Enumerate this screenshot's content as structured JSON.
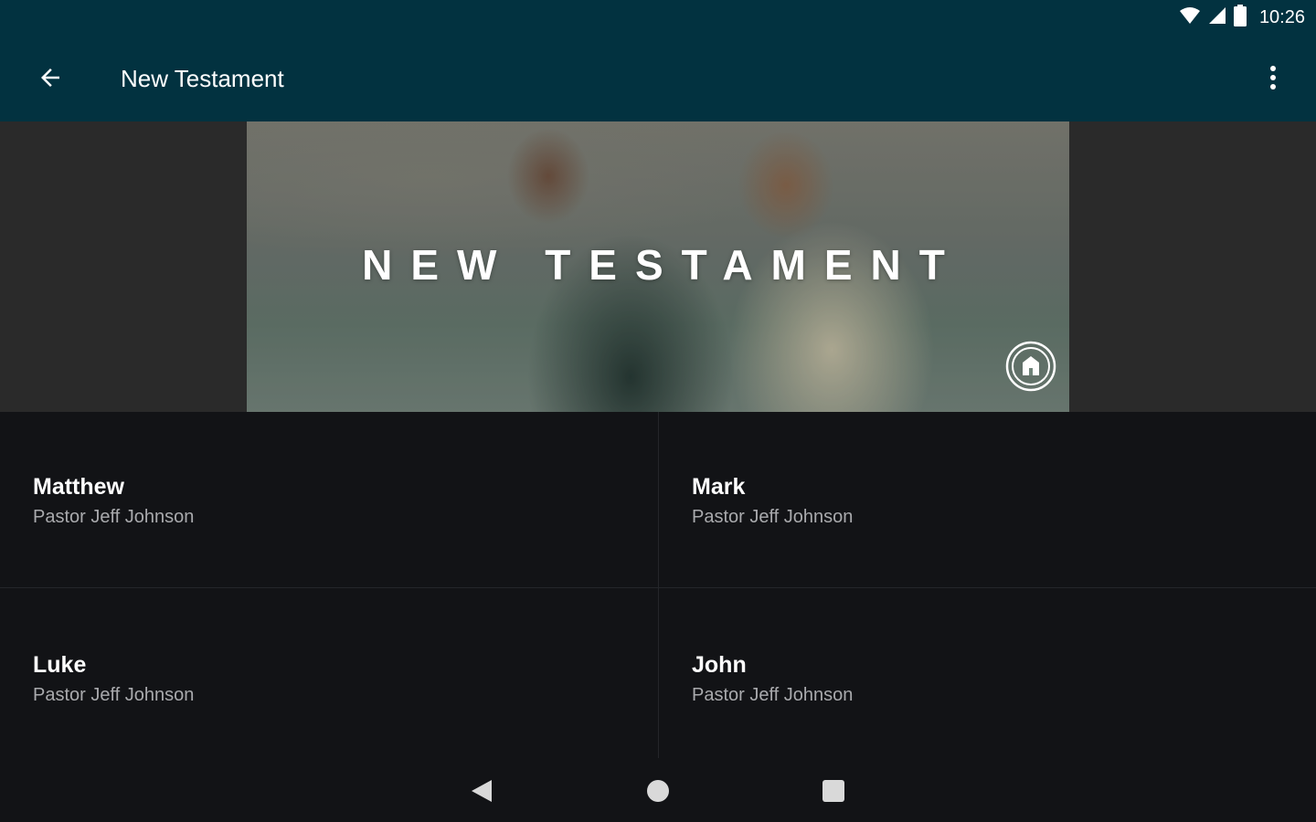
{
  "status_bar": {
    "time": "10:26",
    "icons": [
      "wifi-icon",
      "signal-icon",
      "battery-icon"
    ]
  },
  "app_bar": {
    "title": "New Testament",
    "back_icon": "arrow-back-icon",
    "menu_icon": "more-vert-icon"
  },
  "banner": {
    "title": "NEW TESTAMENT",
    "logo_icon": "church-logo-icon"
  },
  "series": [
    {
      "title": "Matthew",
      "speaker": "Pastor Jeff Johnson"
    },
    {
      "title": "Mark",
      "speaker": "Pastor Jeff Johnson"
    },
    {
      "title": "Luke",
      "speaker": "Pastor Jeff Johnson"
    },
    {
      "title": "John",
      "speaker": "Pastor Jeff Johnson"
    }
  ],
  "nav_bar": {
    "buttons": [
      "nav-back-icon",
      "nav-home-icon",
      "nav-recents-icon"
    ]
  },
  "colors": {
    "app_bar": "#023240",
    "background": "#121316",
    "banner_area": "#2a2a2a",
    "subtitle": "#a9aaad"
  }
}
